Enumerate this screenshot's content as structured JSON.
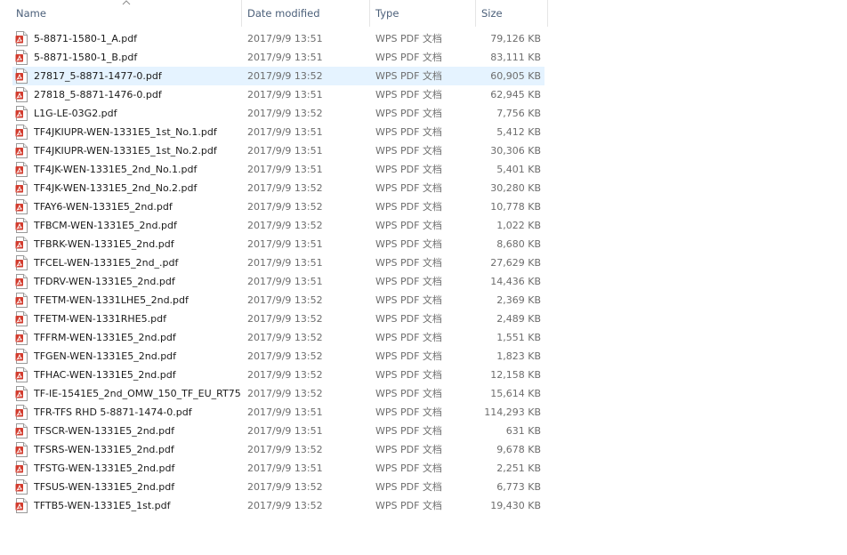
{
  "columns": {
    "name": "Name",
    "date": "Date modified",
    "type": "Type",
    "size": "Size"
  },
  "colors": {
    "header_text": "#4c607a",
    "hover_row": "#e5f3ff",
    "pdf_icon": "#d23b2d"
  },
  "icons": {
    "file": "pdf-file-icon",
    "sort": "sort-ascending-icon"
  },
  "hovered_row": 2,
  "files": [
    {
      "name": "5-8871-1580-1_A.pdf",
      "date": "2017/9/9 13:51",
      "type": "WPS PDF 文档",
      "size": "79,126 KB"
    },
    {
      "name": "5-8871-1580-1_B.pdf",
      "date": "2017/9/9 13:51",
      "type": "WPS PDF 文档",
      "size": "83,111 KB"
    },
    {
      "name": "27817_5-8871-1477-0.pdf",
      "date": "2017/9/9 13:52",
      "type": "WPS PDF 文档",
      "size": "60,905 KB"
    },
    {
      "name": "27818_5-8871-1476-0.pdf",
      "date": "2017/9/9 13:51",
      "type": "WPS PDF 文档",
      "size": "62,945 KB"
    },
    {
      "name": "L1G-LE-03G2.pdf",
      "date": "2017/9/9 13:52",
      "type": "WPS PDF 文档",
      "size": "7,756 KB"
    },
    {
      "name": "TF4JKIUPR-WEN-1331E5_1st_No.1.pdf",
      "date": "2017/9/9 13:51",
      "type": "WPS PDF 文档",
      "size": "5,412 KB"
    },
    {
      "name": "TF4JKIUPR-WEN-1331E5_1st_No.2.pdf",
      "date": "2017/9/9 13:51",
      "type": "WPS PDF 文档",
      "size": "30,306 KB"
    },
    {
      "name": "TF4JK-WEN-1331E5_2nd_No.1.pdf",
      "date": "2017/9/9 13:51",
      "type": "WPS PDF 文档",
      "size": "5,401 KB"
    },
    {
      "name": "TF4JK-WEN-1331E5_2nd_No.2.pdf",
      "date": "2017/9/9 13:52",
      "type": "WPS PDF 文档",
      "size": "30,280 KB"
    },
    {
      "name": "TFAY6-WEN-1331E5_2nd.pdf",
      "date": "2017/9/9 13:52",
      "type": "WPS PDF 文档",
      "size": "10,778 KB"
    },
    {
      "name": "TFBCM-WEN-1331E5_2nd.pdf",
      "date": "2017/9/9 13:52",
      "type": "WPS PDF 文档",
      "size": "1,022 KB"
    },
    {
      "name": "TFBRK-WEN-1331E5_2nd.pdf",
      "date": "2017/9/9 13:51",
      "type": "WPS PDF 文档",
      "size": "8,680 KB"
    },
    {
      "name": "TFCEL-WEN-1331E5_2nd_.pdf",
      "date": "2017/9/9 13:51",
      "type": "WPS PDF 文档",
      "size": "27,629 KB"
    },
    {
      "name": "TFDRV-WEN-1331E5_2nd.pdf",
      "date": "2017/9/9 13:51",
      "type": "WPS PDF 文档",
      "size": "14,436 KB"
    },
    {
      "name": "TFETM-WEN-1331LHE5_2nd.pdf",
      "date": "2017/9/9 13:52",
      "type": "WPS PDF 文档",
      "size": "2,369 KB"
    },
    {
      "name": "TFETM-WEN-1331RHE5.pdf",
      "date": "2017/9/9 13:52",
      "type": "WPS PDF 文档",
      "size": "2,489 KB"
    },
    {
      "name": "TFFRM-WEN-1331E5_2nd.pdf",
      "date": "2017/9/9 13:52",
      "type": "WPS PDF 文档",
      "size": "1,551 KB"
    },
    {
      "name": "TFGEN-WEN-1331E5_2nd.pdf",
      "date": "2017/9/9 13:52",
      "type": "WPS PDF 文档",
      "size": "1,823 KB"
    },
    {
      "name": "TFHAC-WEN-1331E5_2nd.pdf",
      "date": "2017/9/9 13:52",
      "type": "WPS PDF 文档",
      "size": "12,158 KB"
    },
    {
      "name": "TF-IE-1541E5_2nd_OMW_150_TF_EU_RT75...",
      "date": "2017/9/9 13:52",
      "type": "WPS PDF 文档",
      "size": "15,614 KB"
    },
    {
      "name": "TFR-TFS RHD 5-8871-1474-0.pdf",
      "date": "2017/9/9 13:51",
      "type": "WPS PDF 文档",
      "size": "114,293 KB"
    },
    {
      "name": "TFSCR-WEN-1331E5_2nd.pdf",
      "date": "2017/9/9 13:51",
      "type": "WPS PDF 文档",
      "size": "631 KB"
    },
    {
      "name": "TFSRS-WEN-1331E5_2nd.pdf",
      "date": "2017/9/9 13:52",
      "type": "WPS PDF 文档",
      "size": "9,678 KB"
    },
    {
      "name": "TFSTG-WEN-1331E5_2nd.pdf",
      "date": "2017/9/9 13:51",
      "type": "WPS PDF 文档",
      "size": "2,251 KB"
    },
    {
      "name": "TFSUS-WEN-1331E5_2nd.pdf",
      "date": "2017/9/9 13:52",
      "type": "WPS PDF 文档",
      "size": "6,773 KB"
    },
    {
      "name": "TFTB5-WEN-1331E5_1st.pdf",
      "date": "2017/9/9 13:52",
      "type": "WPS PDF 文档",
      "size": "19,430 KB"
    }
  ]
}
